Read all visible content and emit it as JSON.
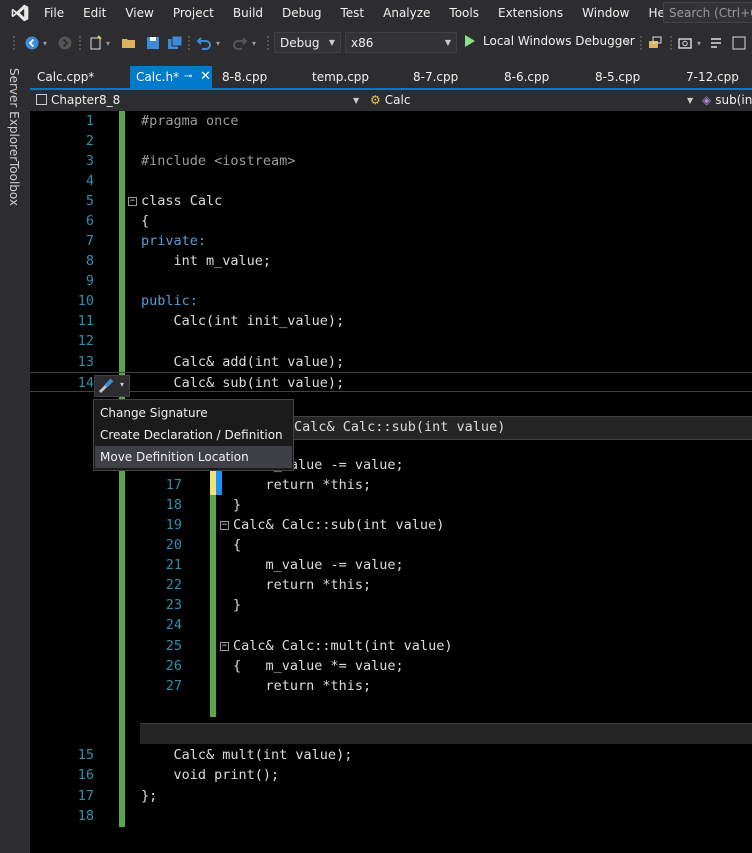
{
  "menu": {
    "items": [
      "File",
      "Edit",
      "View",
      "Project",
      "Build",
      "Debug",
      "Test",
      "Analyze",
      "Tools",
      "Extensions",
      "Window",
      "Help"
    ],
    "search_placeholder": "Search (Ctrl+Q)"
  },
  "toolbar": {
    "config": "Debug",
    "platform": "x86",
    "run_label": "Local Windows Debugger"
  },
  "side_tabs": [
    "Server Explorer",
    "Toolbox"
  ],
  "tabs": [
    {
      "label": "Calc.cpp*",
      "active": false
    },
    {
      "label": "Calc.h*",
      "active": true
    },
    {
      "label": "8-8.cpp",
      "active": false
    },
    {
      "label": "temp.cpp",
      "active": false
    },
    {
      "label": "8-7.cpp",
      "active": false
    },
    {
      "label": "8-6.cpp",
      "active": false
    },
    {
      "label": "8-5.cpp",
      "active": false
    },
    {
      "label": "7-12.cpp",
      "active": false
    }
  ],
  "navbar": {
    "project": "Chapter8_8",
    "scope": "Calc",
    "member": "sub(int value)"
  },
  "editor": {
    "lines": [
      {
        "n": "1",
        "text": "#pragma once"
      },
      {
        "n": "2",
        "text": ""
      },
      {
        "n": "3",
        "text": "#include <iostream>"
      },
      {
        "n": "4",
        "text": ""
      },
      {
        "n": "5",
        "text": "class Calc"
      },
      {
        "n": "6",
        "text": "{"
      },
      {
        "n": "7",
        "text": "private:"
      },
      {
        "n": "8",
        "text": "    int m_value;"
      },
      {
        "n": "9",
        "text": ""
      },
      {
        "n": "10",
        "text": "public:"
      },
      {
        "n": "11",
        "text": "    Calc(int init_value);"
      },
      {
        "n": "12",
        "text": ""
      },
      {
        "n": "13",
        "text": "    Calc& add(int value);"
      },
      {
        "n": "14",
        "text": "    Calc& sub(int value);"
      },
      {
        "n": "15",
        "text": "    Calc& mult(int value);"
      },
      {
        "n": "16",
        "text": "    void print();"
      },
      {
        "n": "17",
        "text": "};"
      },
      {
        "n": "18",
        "text": ""
      }
    ]
  },
  "peek": {
    "header": "Calc& Calc::sub(int value)",
    "lines": [
      {
        "n": "16",
        "text": "    m_value -= value;"
      },
      {
        "n": "17",
        "text": "    return *this;"
      },
      {
        "n": "18",
        "text": "}"
      },
      {
        "n": "19",
        "text": "Calc& Calc::sub(int value)"
      },
      {
        "n": "20",
        "text": "{"
      },
      {
        "n": "21",
        "text": "    m_value -= value;"
      },
      {
        "n": "22",
        "text": "    return *this;"
      },
      {
        "n": "23",
        "text": "}"
      },
      {
        "n": "24",
        "text": ""
      },
      {
        "n": "25",
        "text": "Calc& Calc::mult(int value)"
      },
      {
        "n": "26",
        "text": "{   m_value *= value;"
      },
      {
        "n": "27",
        "text": "    return *this;"
      }
    ]
  },
  "quick_actions": {
    "items": [
      "Change Signature",
      "Create Declaration / Definition",
      "Move Definition Location"
    ],
    "selected": "Move Definition Location"
  }
}
